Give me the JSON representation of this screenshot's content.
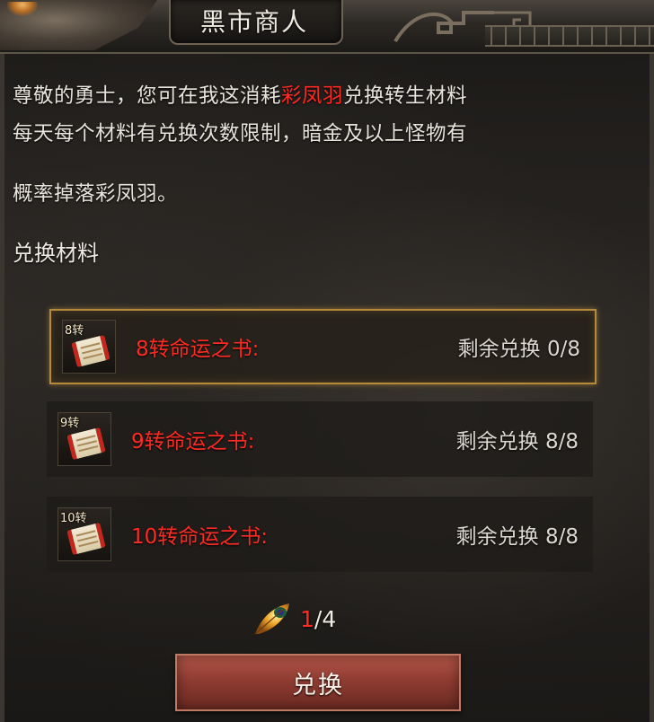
{
  "window": {
    "title": "黑市商人"
  },
  "intro": {
    "line1_before": "尊敬的勇士，您可在我这消耗",
    "line1_highlight": "彩凤羽",
    "line1_after": "兑换转生材料",
    "line2": "每天每个材料有兑换次数限制，暗金及以上怪物有",
    "line3": "概率掉落彩凤羽。"
  },
  "section": {
    "label": "兑换材料"
  },
  "items": [
    {
      "tier": "8转",
      "name": "8转命运之书:",
      "remaining": "剩余兑换 0/8",
      "selected": true,
      "icon": "scroll-icon"
    },
    {
      "tier": "9转",
      "name": "9转命运之书:",
      "remaining": "剩余兑换 8/8",
      "selected": false,
      "icon": "scroll-icon"
    },
    {
      "tier": "10转",
      "name": "10转命运之书:",
      "remaining": "剩余兑换 8/8",
      "selected": false,
      "icon": "scroll-icon"
    }
  ],
  "cost": {
    "icon": "phoenix-feather-icon",
    "current": "1",
    "total": "/4"
  },
  "action": {
    "label": "兑换"
  },
  "colors": {
    "highlight": "#ff2a22",
    "selected_border": "#b58a3a",
    "button": "#8f3c31"
  }
}
